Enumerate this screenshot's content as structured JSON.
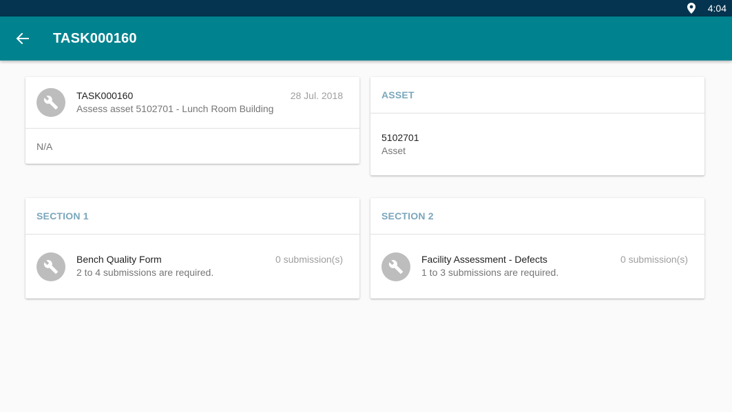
{
  "status_bar": {
    "time": "4:04",
    "location_icon": "location-pin-icon"
  },
  "app_bar": {
    "title": "TASK000160",
    "back_icon": "arrow-back-icon"
  },
  "task_card": {
    "icon": "wrench-icon",
    "id": "TASK000160",
    "description": "Assess asset 5102701 - Lunch Room Building",
    "date": "28 Jul. 2018",
    "note": "N/A"
  },
  "asset_card": {
    "header": "ASSET",
    "value": "5102701",
    "label": "Asset"
  },
  "sections": [
    {
      "header": "SECTION 1",
      "form_name": "Bench Quality Form",
      "requirement": "2 to 4 submissions are required.",
      "submissions": "0 submission(s)",
      "icon": "wrench-icon"
    },
    {
      "header": "SECTION 2",
      "form_name": "Facility Assessment - Defects",
      "requirement": "1 to 3 submissions are required.",
      "submissions": "0 submission(s)",
      "icon": "wrench-icon"
    }
  ],
  "colors": {
    "status_bar": "#04344f",
    "app_bar": "#00838f",
    "section_header": "#7aa6bd",
    "avatar": "#bdbdbd"
  }
}
